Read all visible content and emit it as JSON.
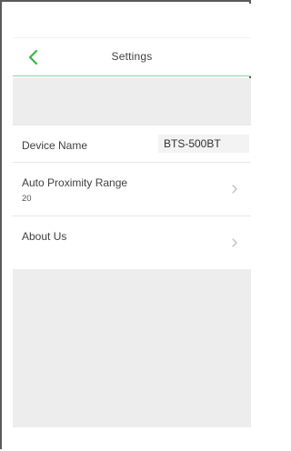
{
  "header": {
    "title": "Settings",
    "back_icon": "chevron-left-icon",
    "accent_color": "#3bb54a"
  },
  "settings": {
    "device_name": {
      "label": "Device Name",
      "value": "BTS-500BT"
    },
    "auto_proximity_range": {
      "label": "Auto Proximity Range",
      "value": "20",
      "chevron_icon": "chevron-right-icon"
    },
    "about_us": {
      "label": "About Us",
      "chevron_icon": "chevron-right-icon"
    }
  }
}
